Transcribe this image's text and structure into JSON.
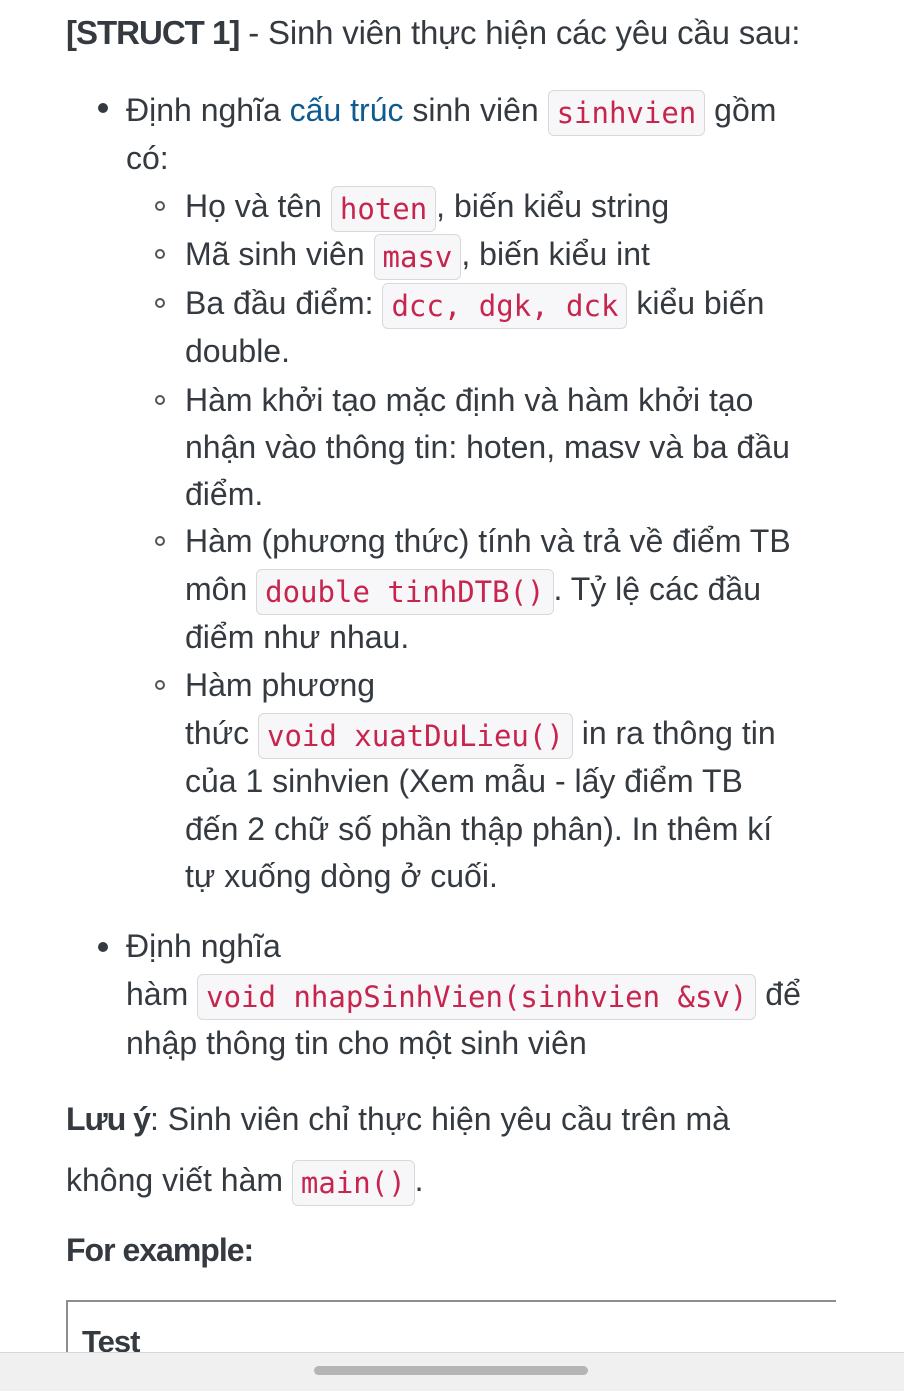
{
  "heading": {
    "prefix": "[STRUCT 1]",
    "text": " - Sinh viên thực hiện các yêu cầu sau:"
  },
  "b1": {
    "t1": "Định nghĩa ",
    "link": "cấu trúc",
    "t2": " sinh viên ",
    "code": "sinhvien",
    "t3": " gồm",
    "cont": "có:"
  },
  "s1": {
    "t1": "Họ và tên ",
    "code": "hoten",
    "t2": ", biến kiểu string"
  },
  "s2": {
    "t1": "Mã sinh viên ",
    "code": "masv",
    "t2": ", biến kiểu int"
  },
  "s3": {
    "t1": "Ba đầu điểm: ",
    "code": "dcc, dgk, dck",
    "t2": " kiểu biến",
    "cont": "double."
  },
  "s4": {
    "l1": "Hàm khởi tạo mặc định và hàm khởi tạo",
    "l2": "nhận vào thông tin: hoten, masv và ba đầu",
    "l3": "điểm."
  },
  "s5": {
    "l1": "Hàm (phương thức) tính và trả về điểm TB",
    "l2a": "môn ",
    "code": "double tinhDTB()",
    "l2b": ". Tỷ lệ các đầu",
    "l3": "điểm như nhau."
  },
  "s6": {
    "l1": "Hàm phương",
    "l2a": "thức ",
    "code": "void xuatDuLieu()",
    "l2b": " in ra thông tin",
    "l3": "của 1 sinhvien (Xem mẫu - lấy điểm TB",
    "l4": "đến 2 chữ số phần thập phân). In thêm kí",
    "l5": "tự xuống dòng ở cuối."
  },
  "b2": {
    "l1": "Định nghĩa",
    "l2a": "hàm ",
    "code": "void nhapSinhVien(sinhvien &sv)",
    "l2b": " để",
    "l3": "nhập thông tin cho một sinh viên"
  },
  "note": {
    "strong": "Lưu ý",
    "t1": ": Sinh viên chỉ thực hiện yêu cầu trên mà",
    "l2a": "không viết hàm ",
    "code": "main()",
    "l2b": "."
  },
  "example": {
    "title": "For example:",
    "table_head": "Test"
  }
}
